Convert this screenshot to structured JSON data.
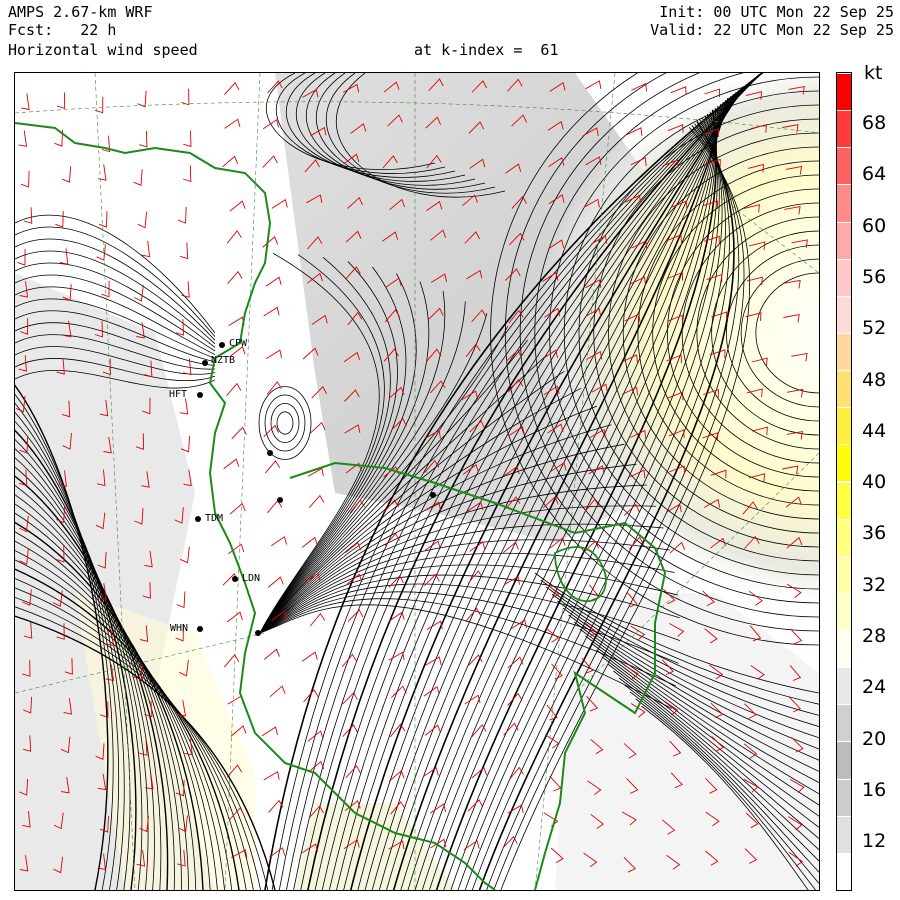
{
  "header": {
    "model": "AMPS 2.67-km WRF",
    "forecast": "Fcst:   22 h",
    "field": "Horizontal wind speed",
    "level": "at k-index =  61",
    "init": "Init: 00 UTC Mon 22 Sep 25",
    "valid": "Valid: 22 UTC Mon 22 Sep 25"
  },
  "colorbar": {
    "unit": "kt",
    "labels": [
      "68",
      "64",
      "60",
      "56",
      "52",
      "48",
      "44",
      "40",
      "36",
      "32",
      "28",
      "24",
      "20",
      "16",
      "12"
    ],
    "colors": [
      "#ff0000",
      "#ff3a3a",
      "#ff6060",
      "#ff8a8a",
      "#ffaaaa",
      "#ffc8c8",
      "#ffdcdc",
      "#ffd8a0",
      "#ffe070",
      "#ffee40",
      "#ffff00",
      "#ffff40",
      "#ffff80",
      "#ffffa8",
      "#ffffc8",
      "#fffff0",
      "#e8e8e8",
      "#d0d0d0",
      "#bcbcbc",
      "#cccccc",
      "#e0e0e0",
      "#ffffff"
    ]
  },
  "stations": [
    "CPW",
    "NZTB",
    "HFT",
    "TDM",
    "LDN",
    "WHN"
  ]
}
